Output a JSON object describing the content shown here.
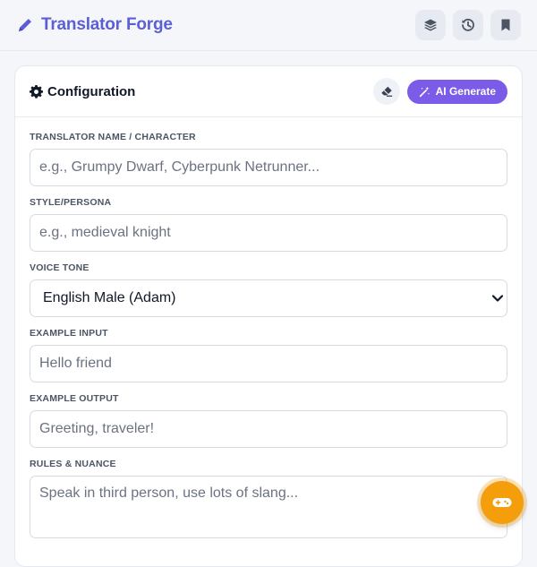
{
  "app": {
    "title": "Translator Forge",
    "accent_color": "#5b5fd6",
    "brand_icon": "pencil-icon"
  },
  "header": {
    "actions": [
      {
        "icon": "layers-icon"
      },
      {
        "icon": "history-icon"
      },
      {
        "icon": "bookmark-icon"
      }
    ]
  },
  "card": {
    "title": "Configuration",
    "title_icon": "gear-icon",
    "clear_icon": "eraser-icon",
    "ai_button_label": "AI Generate",
    "ai_button_color": "#7b5ce8"
  },
  "form": {
    "name": {
      "label": "TRANSLATOR NAME / CHARACTER",
      "value": "",
      "placeholder": "e.g., Grumpy Dwarf, Cyberpunk Netrunner..."
    },
    "style": {
      "label": "STYLE/PERSONA",
      "value": "",
      "placeholder": "e.g., medieval knight"
    },
    "voice": {
      "label": "VOICE TONE",
      "selected": "English Male (Adam)"
    },
    "example_input": {
      "label": "EXAMPLE INPUT",
      "value": "",
      "placeholder": "Hello friend"
    },
    "example_output": {
      "label": "EXAMPLE OUTPUT",
      "value": "",
      "placeholder": "Greeting, traveler!"
    },
    "rules": {
      "label": "RULES & NUANCE",
      "value": "",
      "placeholder": "Speak in third person, use lots of slang..."
    }
  },
  "fab": {
    "icon": "gamepad-icon",
    "color": "#f59e0b"
  }
}
